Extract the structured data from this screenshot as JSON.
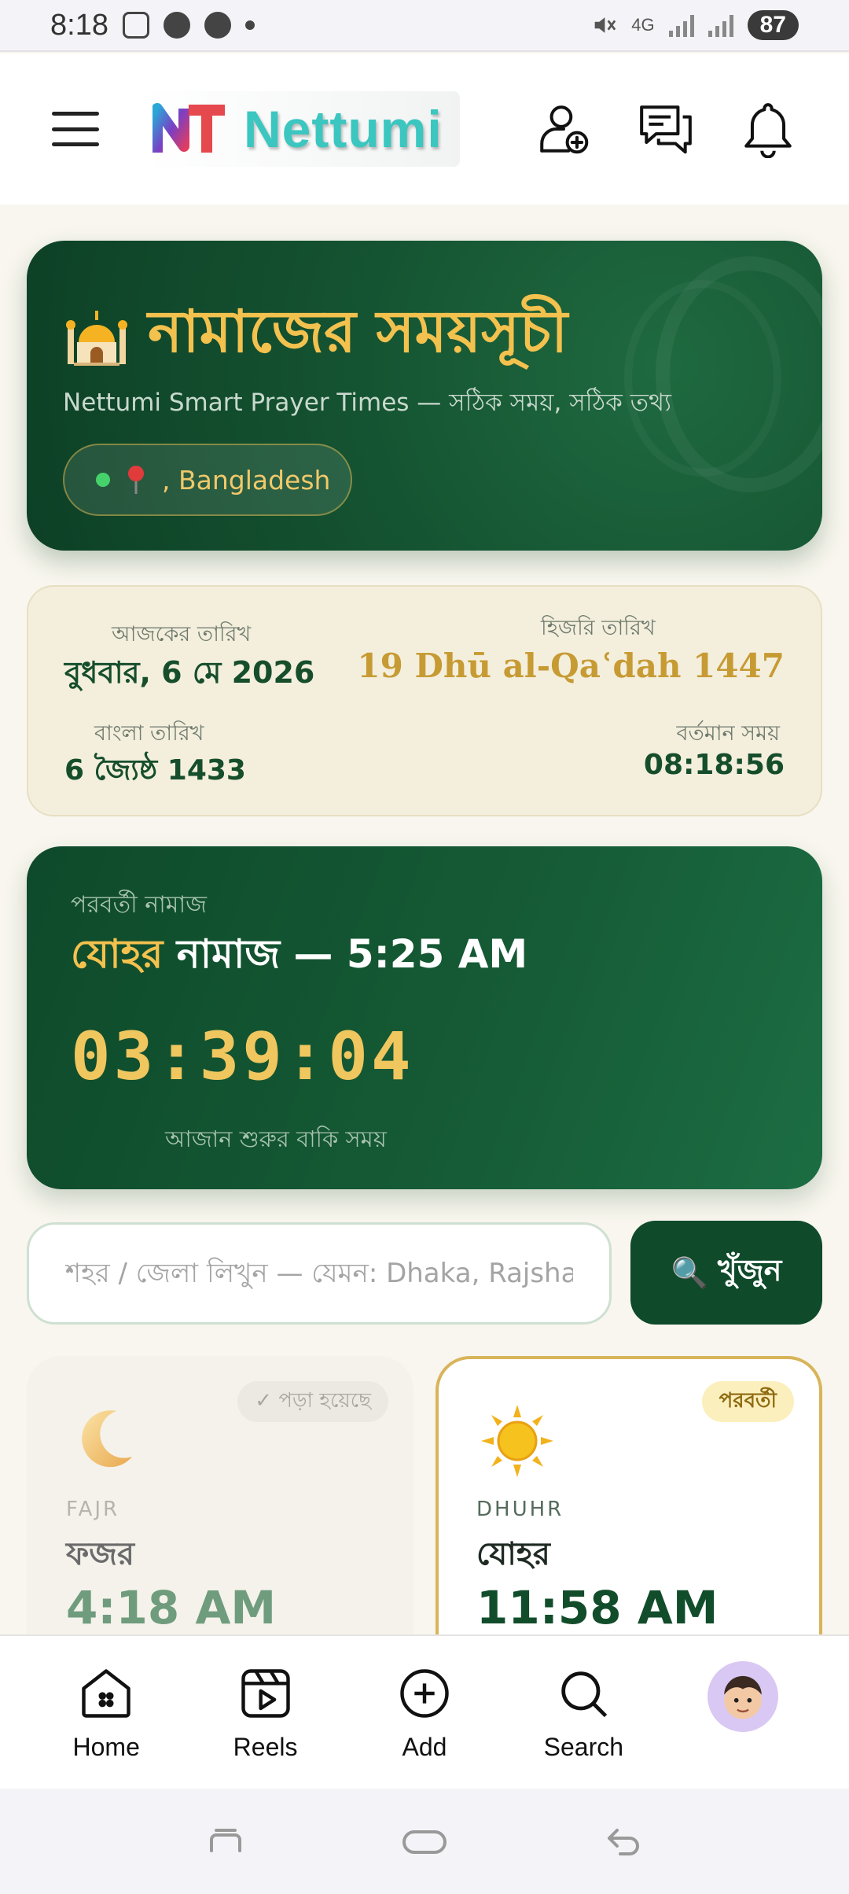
{
  "status_bar": {
    "time": "8:18",
    "network": "4G",
    "battery": "87"
  },
  "header": {
    "brand": "Nettumi",
    "icons": [
      "menu-icon",
      "add-user-icon",
      "chat-icon",
      "bell-icon"
    ]
  },
  "hero": {
    "title": "নামাজের সময়সূচী",
    "subtitle": "Nettumi Smart Prayer Times — সঠিক সময়, সঠিক তথ্য",
    "location": ", Bangladesh"
  },
  "dates": {
    "today_label": "আজকের তারিখ",
    "today_value": "বুধবার, 6 মে 2026",
    "hijri_label": "হিজরি তারিখ",
    "hijri_value": "19 Dhū al-Qaʿdah 1447",
    "bangla_label": "বাংলা তারিখ",
    "bangla_value": "6 জ্যৈষ্ঠ 1433",
    "now_label": "বর্তমান সময়",
    "now_value": "08:18:56"
  },
  "next_prayer": {
    "label": "পরবর্তী নামাজ",
    "name": "যোহর",
    "rest": " নামাজ — 5:25 AM",
    "countdown": "03:39:04",
    "footnote": "আজান শুরুর বাকি সময়"
  },
  "search": {
    "placeholder": "শহর / জেলা লিখুন — যেমন: Dhaka, Rajshahi",
    "button_icon": "🔍",
    "button_label": "খুঁজুন"
  },
  "prayers": [
    {
      "badge": "✓ পড়া হয়েছে",
      "icon": "moon-icon",
      "name_en": "FAJR",
      "name_bn": "ফজর",
      "time": "4:18 AM",
      "state": "done"
    },
    {
      "badge": "পরবর্তী",
      "icon": "sun-icon",
      "name_en": "DHUHR",
      "name_bn": "যোহর",
      "time": "11:58 AM",
      "state": "upcoming"
    }
  ],
  "bottom_nav": {
    "home": "Home",
    "reels": "Reels",
    "add": "Add",
    "search": "Search"
  },
  "colors": {
    "primary_green": "#155432",
    "gold": "#f3c14e",
    "cream": "#f4efdd"
  }
}
